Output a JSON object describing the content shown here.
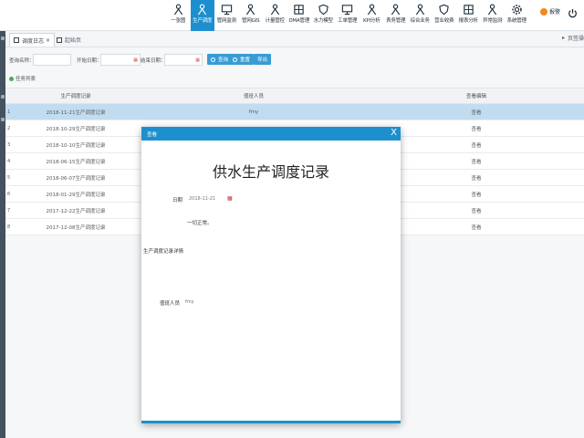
{
  "nav": {
    "items": [
      {
        "label": "一张图",
        "icon": "person-icon"
      },
      {
        "label": "生产调度",
        "icon": "person-icon",
        "active": true
      },
      {
        "label": "管网监测",
        "icon": "monitor-icon"
      },
      {
        "label": "管网GIS",
        "icon": "person-icon"
      },
      {
        "label": "计量管控",
        "icon": "person-icon"
      },
      {
        "label": "DMA管理",
        "icon": "grid-icon"
      },
      {
        "label": "水力模型",
        "icon": "shield-icon"
      },
      {
        "label": "工单管理",
        "icon": "monitor-icon"
      },
      {
        "label": "KPI分析",
        "icon": "person-icon"
      },
      {
        "label": "表务管理",
        "icon": "person-icon"
      },
      {
        "label": "综合业务",
        "icon": "person-icon"
      },
      {
        "label": "营业收费",
        "icon": "shield-icon"
      },
      {
        "label": "报表分析",
        "icon": "grid-icon"
      },
      {
        "label": "异常监测",
        "icon": "person-icon"
      },
      {
        "label": "系统管理",
        "icon": "gear-icon"
      }
    ],
    "alarm_label": "报警",
    "accent_color": "#1d8fcf"
  },
  "tabs": {
    "active_label": "调度日志",
    "other_label": "起始页",
    "right_label": "页签操"
  },
  "search": {
    "label_1": "查询名称：",
    "label_2": "开始日期：",
    "label_3": "结束日期：",
    "search_btn": "查询",
    "reset_btn": "重置",
    "export_btn": "导出"
  },
  "list_title": "任务列表",
  "table": {
    "headers": [
      "生产调度记录",
      "值班人员",
      "查看编辑"
    ],
    "rows": [
      {
        "num": "1",
        "record": "2018-11-21生产调度记录",
        "person": "fmy",
        "action": "查看"
      },
      {
        "num": "2",
        "record": "2018-10-29生产调度记录",
        "person": "",
        "action": "查看"
      },
      {
        "num": "3",
        "record": "2018-10-10生产调度记录",
        "person": "",
        "action": "查看"
      },
      {
        "num": "4",
        "record": "2018-06-15生产调度记录",
        "person": "",
        "action": "查看"
      },
      {
        "num": "5",
        "record": "2018-06-07生产调度记录",
        "person": "",
        "action": "查看"
      },
      {
        "num": "6",
        "record": "2018-01-29生产调度记录",
        "person": "",
        "action": "查看"
      },
      {
        "num": "7",
        "record": "2017-12-22生产调度记录",
        "person": "",
        "action": "查看"
      },
      {
        "num": "8",
        "record": "2017-12-08生产调度记录",
        "person": "",
        "action": "查看"
      }
    ]
  },
  "modal": {
    "header": "查看",
    "close": "X",
    "title": "供水生产调度记录",
    "date_label": "日期",
    "date_value": "2018-11-21",
    "note": "一切正常。",
    "detail_label": "生产调度记录详情",
    "person_label": "值班人员",
    "person_value": "fmy"
  }
}
